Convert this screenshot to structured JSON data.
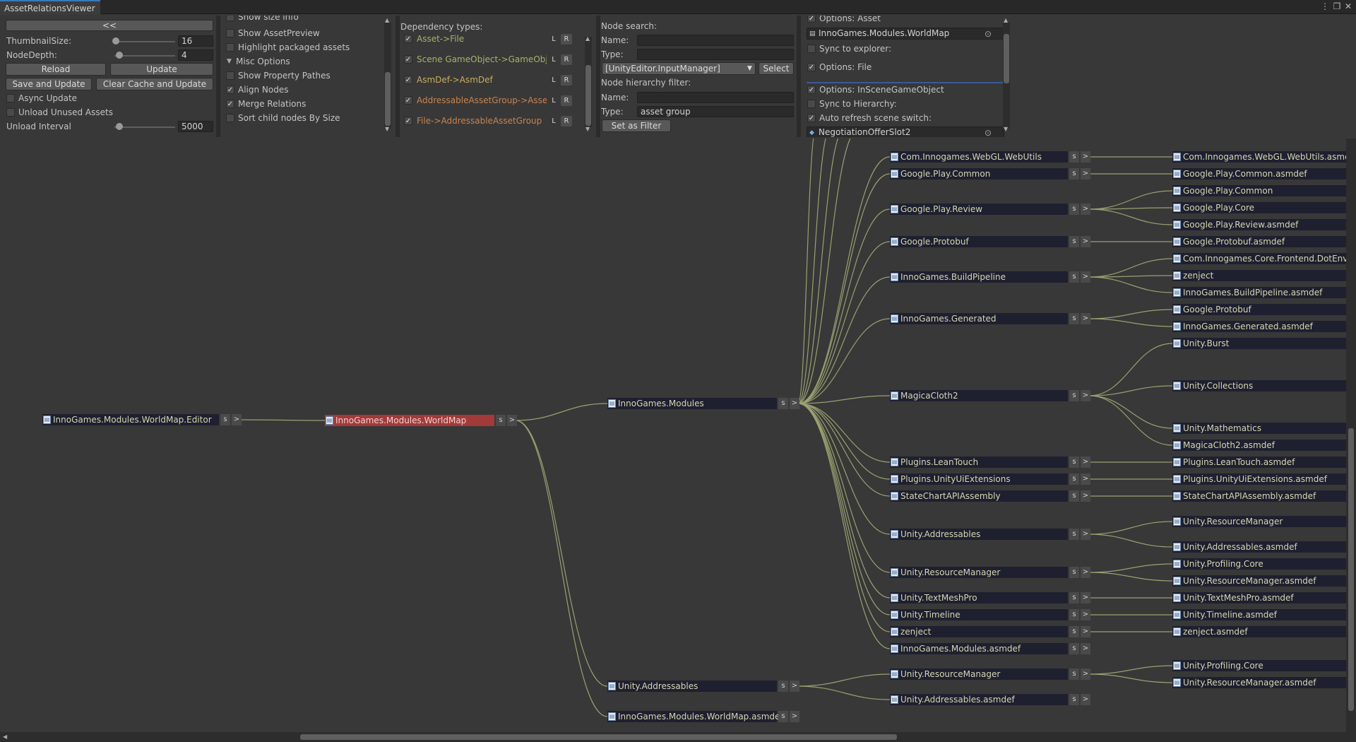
{
  "window": {
    "tab": "AssetRelationsViewer",
    "menu_glyph": "⋮",
    "restore_glyph": "❐",
    "close_glyph": "✕"
  },
  "settings": {
    "collapse_label": "<<",
    "thumbnail_label": "ThumbnailSize:",
    "thumbnail_value": "16",
    "depth_label": "NodeDepth:",
    "depth_value": "4",
    "reload_label": "Reload",
    "update_label": "Update",
    "save_update_label": "Save and Update",
    "clear_cache_label": "Clear Cache and Update",
    "async_label": "Async Update",
    "unload_label": "Unload Unused Assets",
    "interval_label": "Unload Interval",
    "interval_value": "5000"
  },
  "display": {
    "show_size": "Show size info",
    "show_preview": "Show AssetPreview",
    "highlight": "Highlight packaged assets",
    "misc": "Misc Options",
    "property_pathes": "Show Property Pathes",
    "align_nodes": "Align Nodes",
    "merge_relations": "Merge Relations",
    "sort_child": "Sort child nodes By Size"
  },
  "dependency": {
    "heading": "Dependency types:",
    "l": "L",
    "r": "R",
    "types": [
      {
        "label": "Asset->File",
        "color": "#a4b468"
      },
      {
        "label": "Scene GameObject->GameObject",
        "color": "#a4b468"
      },
      {
        "label": "AsmDef->AsmDef",
        "color": "#c9ad5e"
      },
      {
        "label": "AddressableAssetGroup->Asset",
        "color": "#c9834f"
      },
      {
        "label": "File->AddressableAssetGroup",
        "color": "#c9834f"
      }
    ]
  },
  "search": {
    "node_search": "Node search:",
    "name_label": "Name:",
    "type_label": "Type:",
    "type_dropdown": "[UnityEditor.InputManager] InputManager",
    "select_label": "Select",
    "hierarchy_filter": "Node hierarchy filter:",
    "filter_name_label": "Name:",
    "filter_type_label": "Type:",
    "filter_type_value": "asset group",
    "set_filter_label": "Set as Filter"
  },
  "options": {
    "asset_header": "Options: Asset",
    "asset_object": "InnoGames.Modules.WorldMap",
    "sync_explorer": "Sync to explorer:",
    "file_header": "Options: File",
    "scene_header": "Options: InSceneGameObject",
    "sync_hierarchy": "Sync to Hierarchy:",
    "auto_refresh": "Auto refresh scene switch:",
    "scene_object": "NegotiationOfferSlot2"
  },
  "graph": {
    "s": "s",
    "expand": ">",
    "edge_color": "#9aa070",
    "nodes": [
      {
        "label": "InnoGames.Modules.WorldMap.Editor"
      },
      {
        "label": "InnoGames.Modules.WorldMap"
      },
      {
        "label": "InnoGames.Modules"
      },
      {
        "label": "Unity.Addressables"
      },
      {
        "label": "InnoGames.Modules.WorldMap.asmdef"
      },
      {
        "label": "Com.Innogames.WebGL.WebUtils"
      },
      {
        "label": "Google.Play.Common"
      },
      {
        "label": "Google.Play.Review"
      },
      {
        "label": "Google.Protobuf"
      },
      {
        "label": "InnoGames.BuildPipeline"
      },
      {
        "label": "InnoGames.Generated"
      },
      {
        "label": "MagicaCloth2"
      },
      {
        "label": "Plugins.LeanTouch"
      },
      {
        "label": "Plugins.UnityUiExtensions"
      },
      {
        "label": "StateChartAPIAssembly"
      },
      {
        "label": "Unity.Addressables"
      },
      {
        "label": "Unity.ResourceManager"
      },
      {
        "label": "Unity.TextMeshPro"
      },
      {
        "label": "Unity.Timeline"
      },
      {
        "label": "zenject"
      },
      {
        "label": "InnoGames.Modules.asmdef"
      },
      {
        "label": "Unity.ResourceManager"
      },
      {
        "label": "Unity.Addressables.asmdef"
      },
      {
        "label": "Com.Innogames.WebGL.WebUtils.asmdef"
      },
      {
        "label": "Google.Play.Common.asmdef"
      },
      {
        "label": "Google.Play.Common"
      },
      {
        "label": "Google.Play.Core"
      },
      {
        "label": "Google.Play.Review.asmdef"
      },
      {
        "label": "Google.Protobuf.asmdef"
      },
      {
        "label": "Com.Innogames.Core.Frontend.DotEnvP"
      },
      {
        "label": "zenject"
      },
      {
        "label": "InnoGames.BuildPipeline.asmdef"
      },
      {
        "label": "Google.Protobuf"
      },
      {
        "label": "InnoGames.Generated.asmdef"
      },
      {
        "label": "Unity.Burst"
      },
      {
        "label": "Unity.Collections"
      },
      {
        "label": "Unity.Mathematics"
      },
      {
        "label": "MagicaCloth2.asmdef"
      },
      {
        "label": "Plugins.LeanTouch.asmdef"
      },
      {
        "label": "Plugins.UnityUiExtensions.asmdef"
      },
      {
        "label": "StateChartAPIAssembly.asmdef"
      },
      {
        "label": "Unity.ResourceManager"
      },
      {
        "label": "Unity.Addressables.asmdef"
      },
      {
        "label": "Unity.Profiling.Core"
      },
      {
        "label": "Unity.ResourceManager.asmdef"
      },
      {
        "label": "Unity.TextMeshPro.asmdef"
      },
      {
        "label": "Unity.Timeline.asmdef"
      },
      {
        "label": "zenject.asmdef"
      },
      {
        "label": "Unity.Profiling.Core"
      },
      {
        "label": "Unity.ResourceManager.asmdef"
      }
    ]
  }
}
